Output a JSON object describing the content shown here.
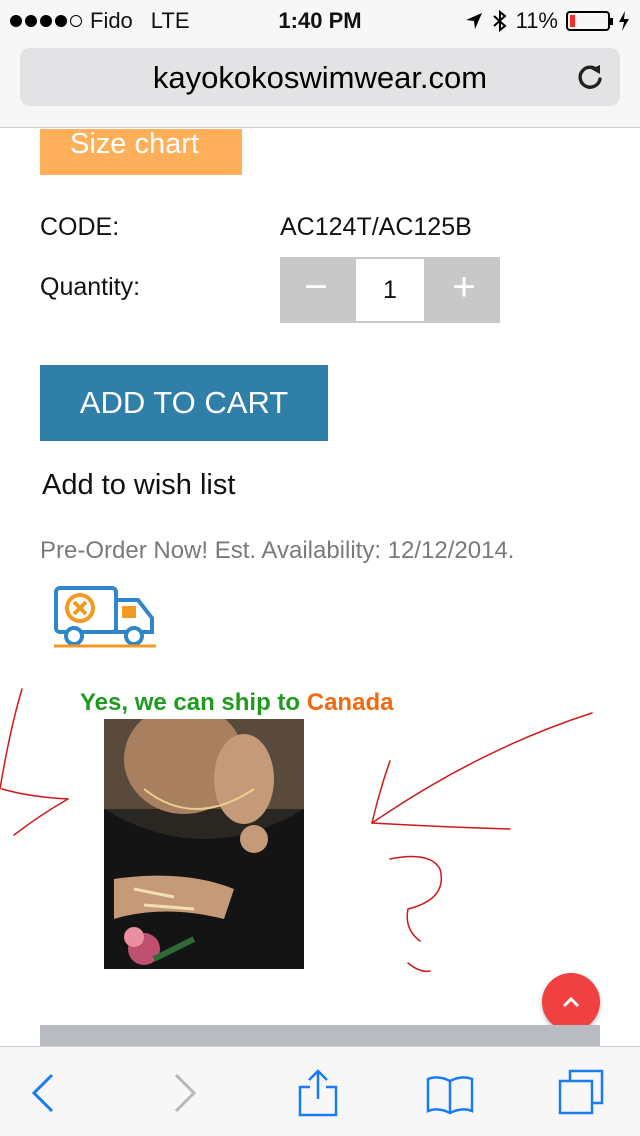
{
  "status_bar": {
    "carrier": "Fido",
    "network": "LTE",
    "time": "1:40 PM",
    "battery": "11%",
    "signal_bars_filled": 4,
    "signal_bars_total": 5
  },
  "browser": {
    "url": "kayokokoswimwear.com",
    "reload_icon": "reload-icon"
  },
  "product": {
    "size_chart_label": "Size chart",
    "code_label": "CODE:",
    "code_value": "AC124T/AC125B",
    "quantity_label": "Quantity:",
    "quantity_value": "1",
    "minus_symbol": "−",
    "plus_symbol": "+",
    "add_to_cart_label": "ADD TO CART",
    "wish_list_label": "Add to wish list",
    "preorder_text": "Pre-Order Now! Est. Availability: 12/12/2014.",
    "shipping_text": "Yes, we can ship to ",
    "shipping_country": "Canada"
  },
  "colors": {
    "size_chart_bg": "#ffae5a",
    "add_to_cart_bg": "#2f7fa8",
    "shipping_green": "#1e9b1e",
    "shipping_orange": "#f06a11",
    "back_to_top_bg": "#f04040",
    "ios_blue": "#1a7cf5"
  },
  "toolbar": {
    "icons": [
      "back-icon",
      "forward-icon",
      "share-icon",
      "bookmarks-icon",
      "tabs-icon"
    ]
  }
}
